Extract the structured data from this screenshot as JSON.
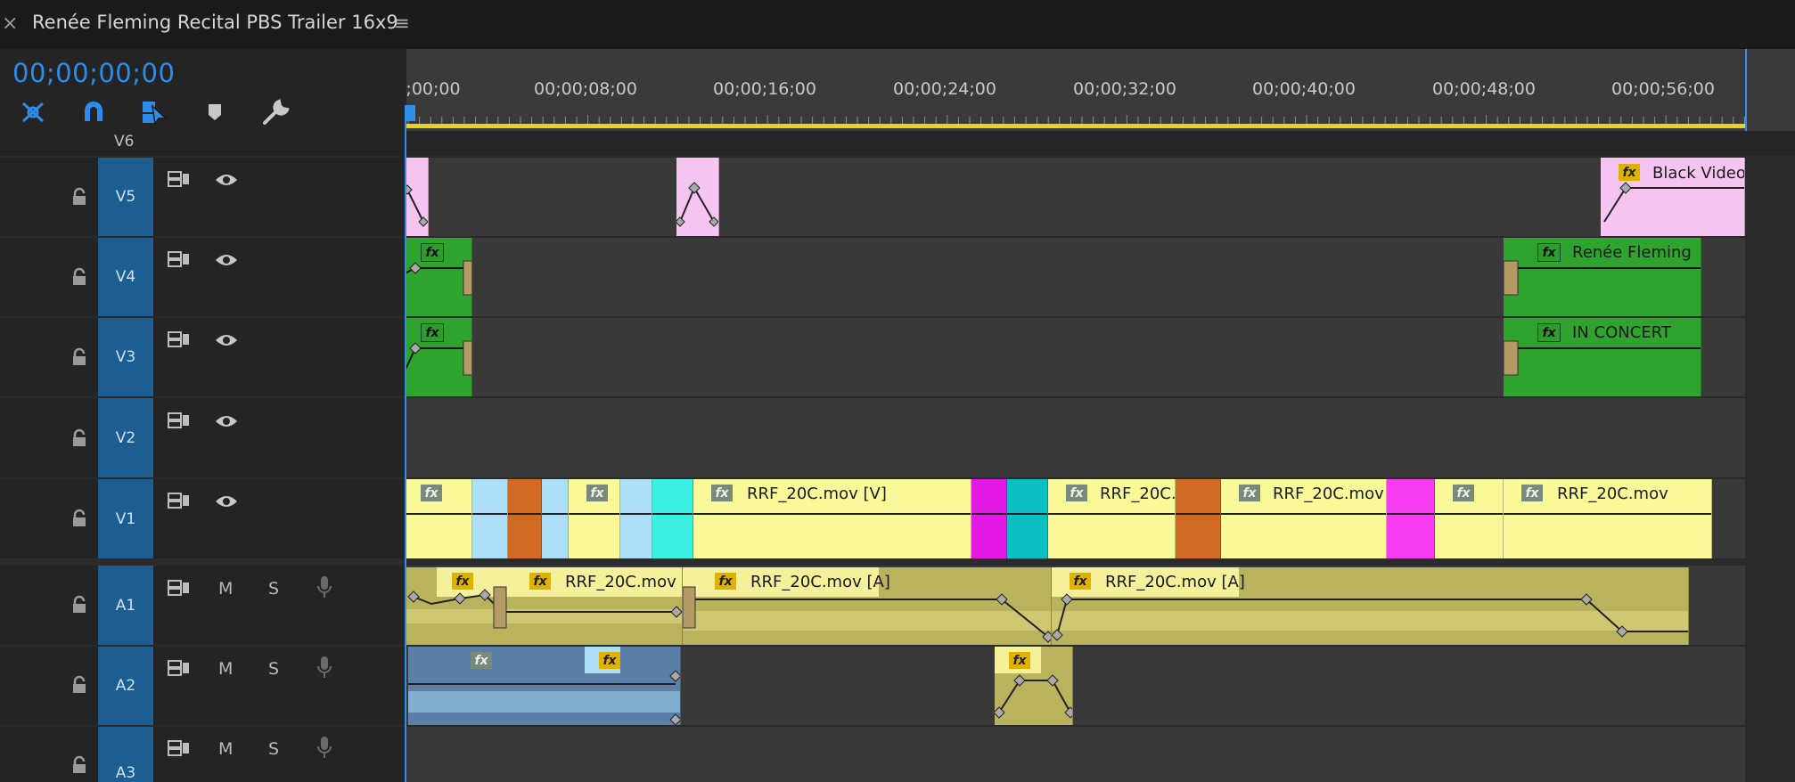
{
  "sequence_tab": {
    "title": "Renée Fleming Recital PBS Trailer 16x9",
    "close_icon": "close-icon",
    "menu_icon": "hamburger-menu-icon"
  },
  "timecode": "00;00;00;00",
  "colors": {
    "accent": "#2d8ceb",
    "track_target": "#1c5d92",
    "yellow_clip": "#f9f99a",
    "green_clip": "#2ea42e",
    "pink_clip": "#f6c4f0",
    "audio_clip": "#b9b35e",
    "work_area": "#e8d41f"
  },
  "toolbar": [
    {
      "name": "nest-toggle-icon"
    },
    {
      "name": "snap-magnet-icon"
    },
    {
      "name": "linked-selection-icon"
    },
    {
      "name": "add-marker-icon"
    },
    {
      "name": "settings-wrench-icon"
    }
  ],
  "ruler": {
    "labels": [
      ";00;00",
      "00;00;08;00",
      "00;00;16;00",
      "00;00;24;00",
      "00;00;32;00",
      "00;00;40;00",
      "00;00;48;00",
      "00;00;56;00"
    ]
  },
  "tracks": {
    "v6": {
      "label": "V6"
    },
    "v5": {
      "label": "V5"
    },
    "v4": {
      "label": "V4"
    },
    "v3": {
      "label": "V3"
    },
    "v2": {
      "label": "V2"
    },
    "v1": {
      "label": "V1"
    },
    "a1": {
      "label": "A1",
      "mute": "M",
      "solo": "S"
    },
    "a2": {
      "label": "A2",
      "mute": "M",
      "solo": "S"
    },
    "a3": {
      "label": "A3",
      "mute": "M",
      "solo": "S"
    }
  },
  "clips": {
    "v5_black": "Black Video",
    "v4_title": "Renée Fleming",
    "v3_title": "IN CONCERT",
    "v1_main": "RRF_20C.mov [V]",
    "v1_b": "RRF_20C.",
    "v1_c": "RRF_20C.mov",
    "v1_d": "RRF_20C.mov",
    "a1_a": "RRF_20C.mov",
    "a1_b": "RRF_20C.mov [A]",
    "a1_c": "RRF_20C.mov [A]",
    "fx": "fx"
  }
}
